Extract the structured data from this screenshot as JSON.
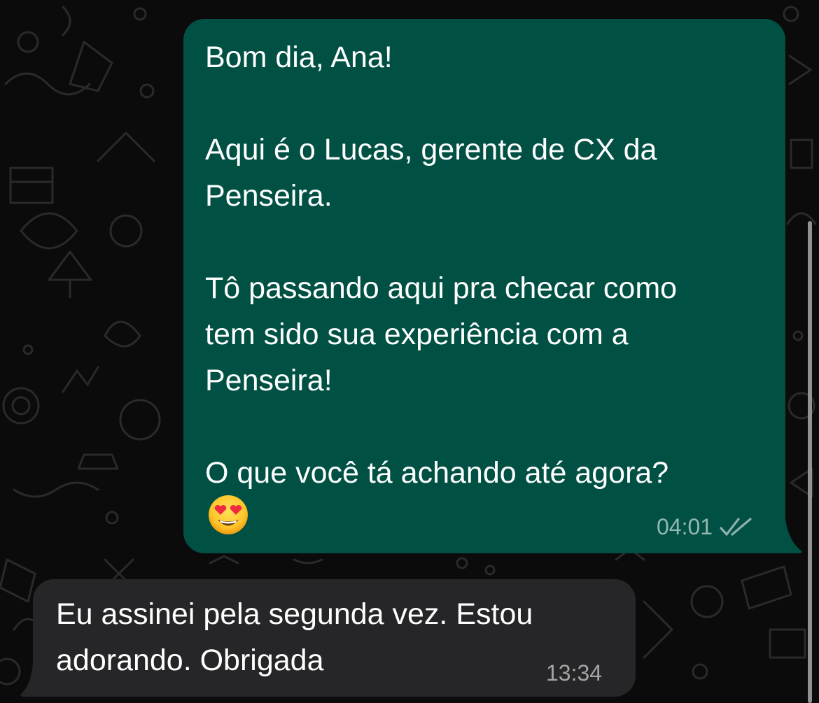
{
  "conversation": {
    "outgoing": {
      "lines": [
        "Bom dia, Ana!",
        "",
        "Aqui é o Lucas, gerente de CX da",
        "Penseira.",
        "",
        "Tô passando aqui pra checar como",
        "tem sido sua experiência com a",
        "Penseira!",
        "",
        "O que você tá achando até agora?"
      ],
      "emoji": "smiling-face-with-heart-eyes",
      "time": "04:01",
      "status_icon": "double-check-icon"
    },
    "incoming": {
      "lines": [
        "Eu assinei pela segunda vez. Estou",
        "adorando. Obrigada"
      ],
      "time": "13:34"
    }
  },
  "colors": {
    "background": "#0b0b0b",
    "outgoing_bubble": "#005144",
    "incoming_bubble": "#262628",
    "text": "#ffffff",
    "meta_text": "#8fb1ab"
  }
}
